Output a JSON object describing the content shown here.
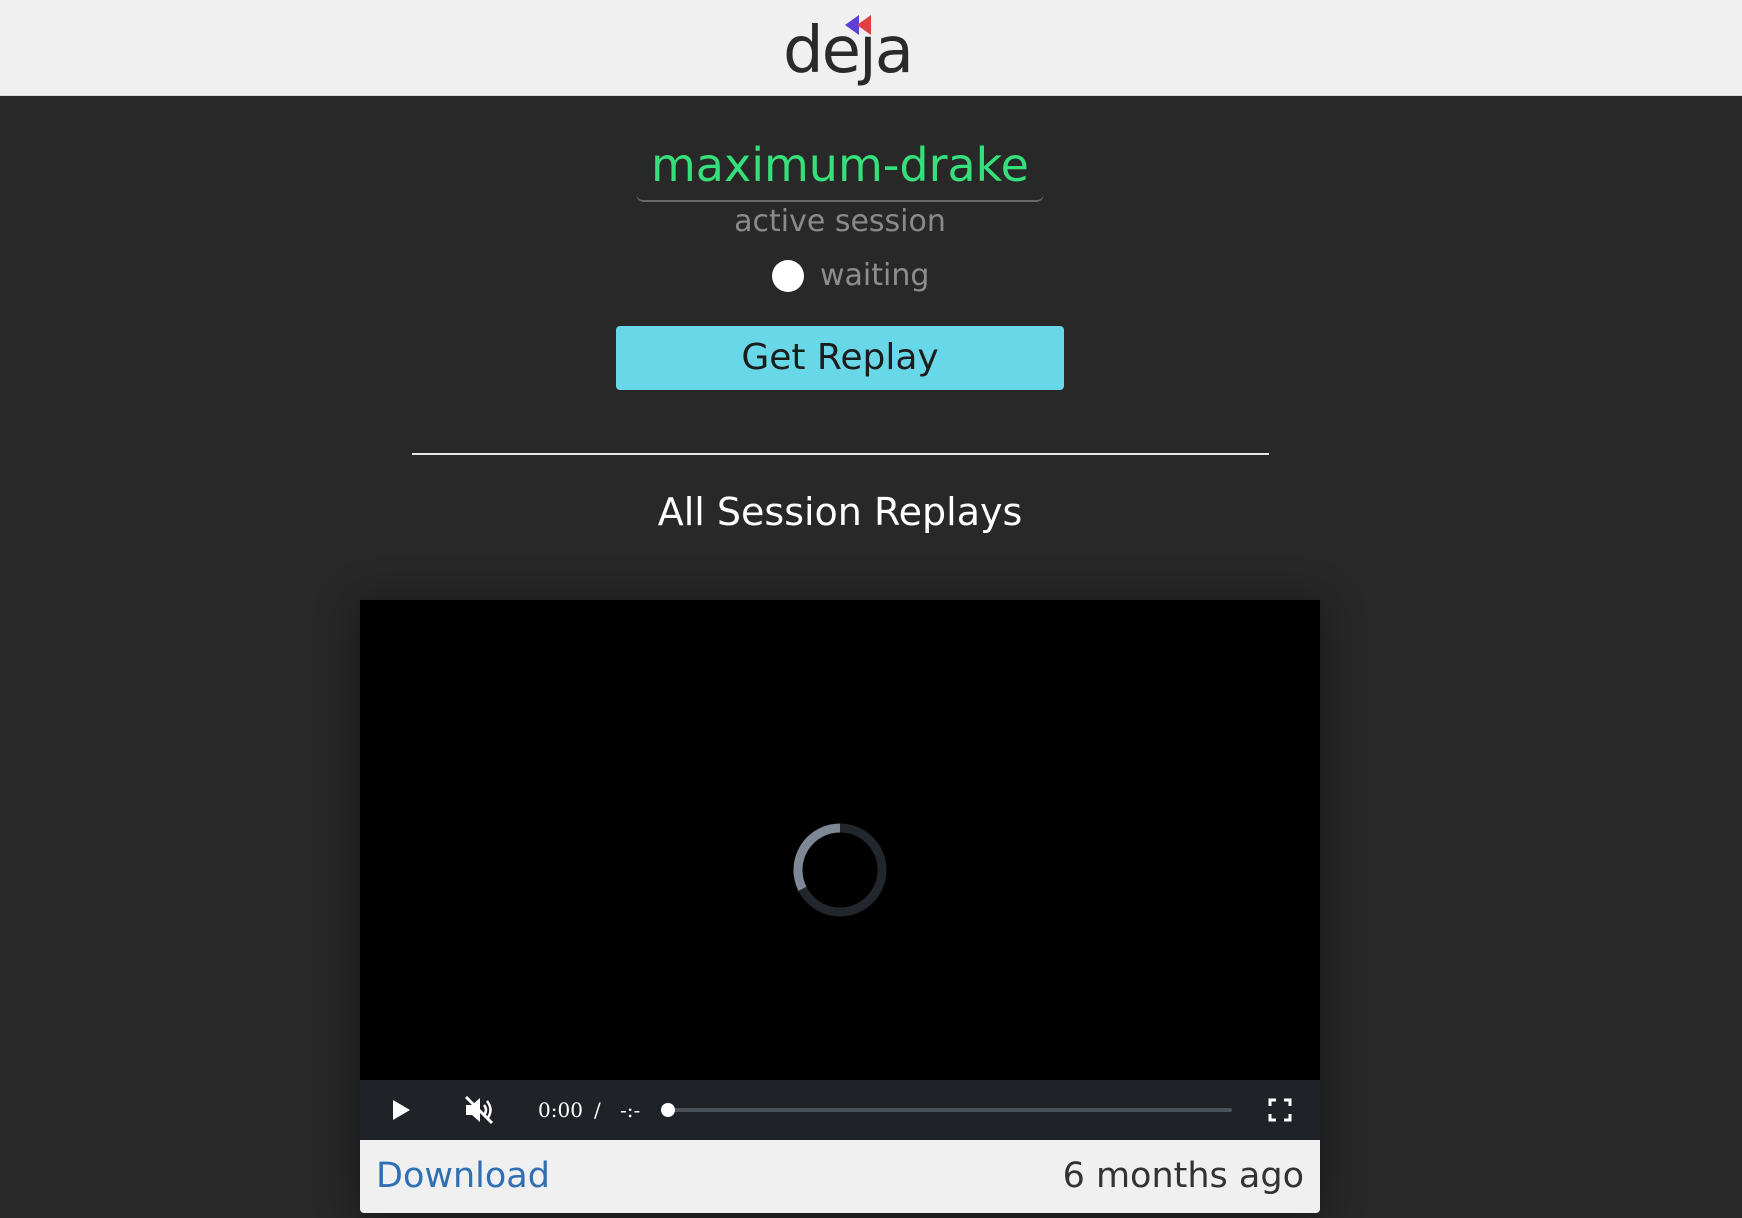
{
  "header": {
    "logo_text": "deja",
    "logo_mark_colors": [
      "#e33d3d",
      "#5b3fd6"
    ]
  },
  "session": {
    "name": "maximum-drake",
    "label": "active session",
    "status": "waiting",
    "name_color": "#35e07a"
  },
  "actions": {
    "get_replay_label": "Get Replay",
    "button_color": "#68d8e8"
  },
  "replays": {
    "title": "All Session Replays",
    "items": [
      {
        "player": {
          "state": "loading",
          "current_time": "0:00",
          "separator": "/",
          "duration": "-:-",
          "progress": 0,
          "muted": true
        },
        "download_label": "Download",
        "age": "6 months ago"
      }
    ]
  }
}
